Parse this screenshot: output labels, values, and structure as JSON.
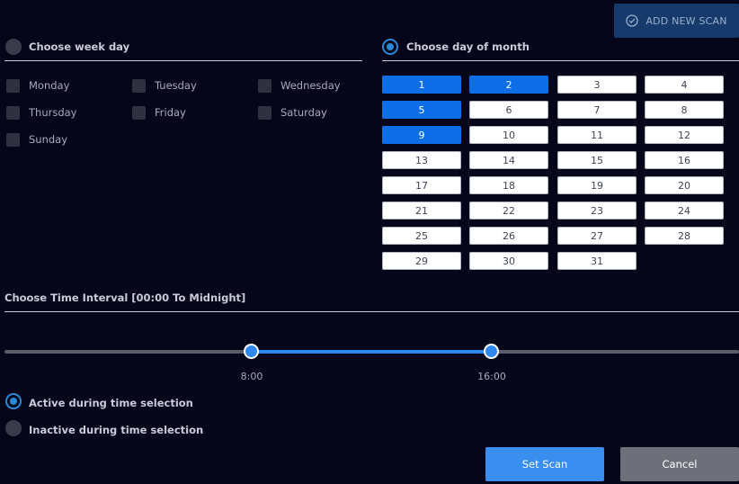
{
  "header": {
    "add_new_scan_label": "ADD NEW SCAN",
    "add_new_scan_icon": "check-circle-icon"
  },
  "week_day_section": {
    "label": "Choose week day",
    "selected": false,
    "days": [
      {
        "label": "Monday",
        "checked": false
      },
      {
        "label": "Tuesday",
        "checked": false
      },
      {
        "label": "Wednesday",
        "checked": false
      },
      {
        "label": "Thursday",
        "checked": false
      },
      {
        "label": "Friday",
        "checked": false
      },
      {
        "label": "Saturday",
        "checked": false
      },
      {
        "label": "Sunday",
        "checked": false
      }
    ]
  },
  "month_day_section": {
    "label": "Choose day of month",
    "selected": true,
    "days": [
      "1",
      "2",
      "3",
      "4",
      "5",
      "6",
      "7",
      "8",
      "9",
      "10",
      "11",
      "12",
      "13",
      "14",
      "15",
      "16",
      "17",
      "18",
      "19",
      "20",
      "21",
      "22",
      "23",
      "24",
      "25",
      "26",
      "27",
      "28",
      "29",
      "30",
      "31"
    ],
    "selected_days": [
      "1",
      "2",
      "5",
      "9"
    ]
  },
  "time_interval": {
    "label": "Choose Time Interval [00:00 To Midnight]",
    "start_label": "8:00",
    "end_label": "16:00",
    "start_fraction": 0.333,
    "end_fraction": 0.667
  },
  "mode": {
    "active_label": "Active during time selection",
    "inactive_label": "Inactive during time selection",
    "active_selected": true
  },
  "actions": {
    "set_scan_label": "Set Scan",
    "cancel_label": "Cancel"
  },
  "colors": {
    "background": "#05061a",
    "accent": "#2b88d8",
    "selected_day": "#0e6ee8",
    "primary_button": "#3a8ef0",
    "secondary_button": "#6d7079"
  }
}
